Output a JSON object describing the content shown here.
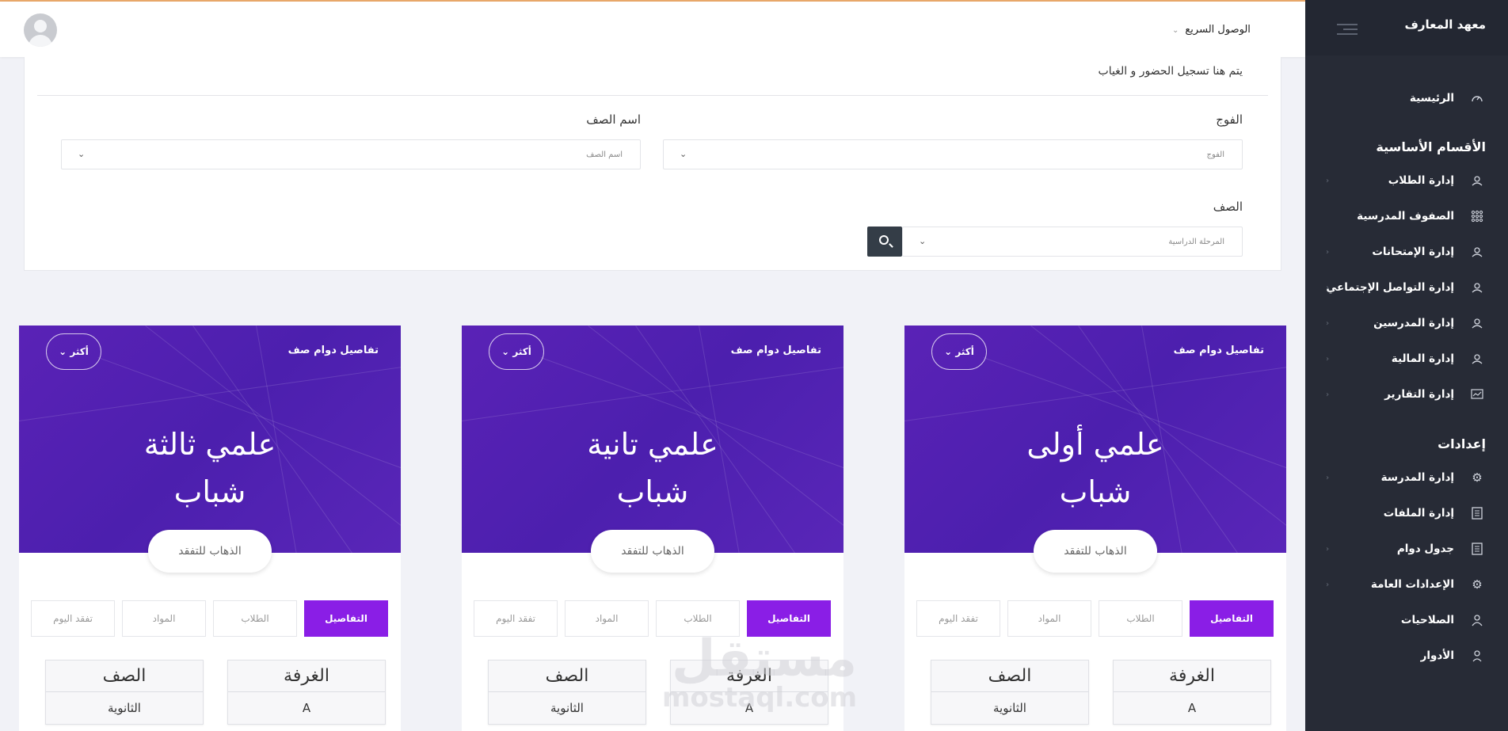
{
  "sidebar": {
    "brand": "معهد المعارف",
    "home": "الرئيسية",
    "section_main": "الأقسام الأساسية",
    "main_items": [
      {
        "label": "إدارة الطلاب",
        "icon": "group-icon"
      },
      {
        "label": "الصفوف المدرسية",
        "icon": "grid-icon"
      },
      {
        "label": "إدارة الإمتحانات",
        "icon": "group-icon"
      },
      {
        "label": "إدارة التواصل الإجتماعي",
        "icon": "group-icon"
      },
      {
        "label": "إدارة المدرسين",
        "icon": "group-icon"
      },
      {
        "label": "إدارة المالية",
        "icon": "group-icon"
      },
      {
        "label": "إدارة التقارير",
        "icon": "chart-icon"
      }
    ],
    "section_settings": "إعدادات",
    "settings_items": [
      {
        "label": "إدارة المدرسة",
        "icon": "gear-icon"
      },
      {
        "label": "إدارة الملفات",
        "icon": "file-icon"
      },
      {
        "label": "جدول دوام",
        "icon": "file-icon"
      },
      {
        "label": "الإعدادات العامة",
        "icon": "gear-icon"
      },
      {
        "label": "الصلاحيات",
        "icon": "user-icon"
      },
      {
        "label": "الأدوار",
        "icon": "user-icon"
      }
    ]
  },
  "header": {
    "quick_access": "الوصول السريع"
  },
  "filter": {
    "description": "يتم هنا تسجيل الحضور و الغياب",
    "batch_label": "الفوج",
    "batch_placeholder": "الفوج",
    "class_name_label": "اسم الصف",
    "class_name_placeholder": "اسم الصف",
    "class_label": "الصف",
    "stage_placeholder": "المرحلة الدراسية"
  },
  "cards": [
    {
      "subtitle": "تفاصيل دوام صف",
      "more": "أكثر",
      "title_line1": "علمي أولى",
      "title_line2": "شباب",
      "go": "الذهاب للتفقد",
      "tabs": [
        "التفاصيل",
        "الطلاب",
        "المواد",
        "تفقد اليوم"
      ],
      "room_label": "الغرفة",
      "room_value": "A",
      "class_label": "الصف",
      "class_value": "الثانوية"
    },
    {
      "subtitle": "تفاصيل دوام صف",
      "more": "أكثر",
      "title_line1": "علمي تانية",
      "title_line2": "شباب",
      "go": "الذهاب للتفقد",
      "tabs": [
        "التفاصيل",
        "الطلاب",
        "المواد",
        "تفقد اليوم"
      ],
      "room_label": "الغرفة",
      "room_value": "A",
      "class_label": "الصف",
      "class_value": "الثانوية"
    },
    {
      "subtitle": "تفاصيل دوام صف",
      "more": "أكثر",
      "title_line1": "علمي ثالثة",
      "title_line2": "شباب",
      "go": "الذهاب للتفقد",
      "tabs": [
        "التفاصيل",
        "الطلاب",
        "المواد",
        "تفقد اليوم"
      ],
      "room_label": "الغرفة",
      "room_value": "A",
      "class_label": "الصف",
      "class_value": "الثانوية"
    }
  ],
  "watermark": {
    "arabic": "مستقل",
    "latin": "mostaql.com"
  },
  "colors": {
    "sidebar": "#272b36",
    "accent": "#8a1ee6",
    "hero": "#5a22b6",
    "search_button": "#343d47"
  }
}
